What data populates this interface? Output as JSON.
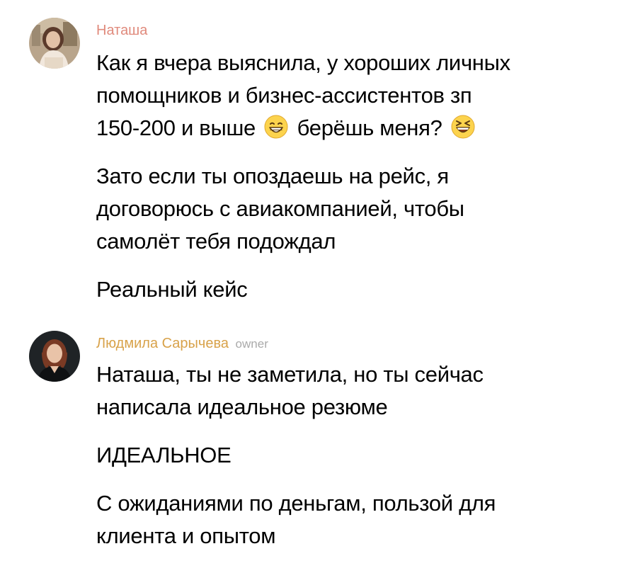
{
  "messages": [
    {
      "author": "Наташа",
      "role": "",
      "paragraphs": [
        {
          "lines": [
            "Как я вчера выяснила, у хороших личных",
            "помощников и бизнес-ассистентов зп",
            "150-200 и выше",
            "берёшь меня?"
          ]
        },
        {
          "lines": [
            "Зато если ты опоздаешь на рейс, я",
            "договорюсь с авиакомпанией, чтобы",
            "самолёт тебя подождал"
          ]
        },
        {
          "lines": [
            "Реальный кейс"
          ]
        }
      ],
      "emojis": [
        "grinning-face-emoji",
        "laughing-squinting-face-emoji"
      ]
    },
    {
      "author": "Людмила Сарычева",
      "role": "owner",
      "paragraphs": [
        {
          "lines": [
            "Наташа, ты не заметила, но ты сейчас",
            "написала идеальное резюме"
          ]
        },
        {
          "lines": [
            "ИДЕАЛЬНОЕ"
          ]
        },
        {
          "lines": [
            "С ожиданиями по деньгам, пользой для",
            "клиента и опытом"
          ]
        }
      ]
    }
  ],
  "colors": {
    "author_1": "#e08a7c",
    "author_2": "#d8a24a",
    "role_badge": "#aaaaaa",
    "text": "#000000",
    "background": "#ffffff"
  }
}
